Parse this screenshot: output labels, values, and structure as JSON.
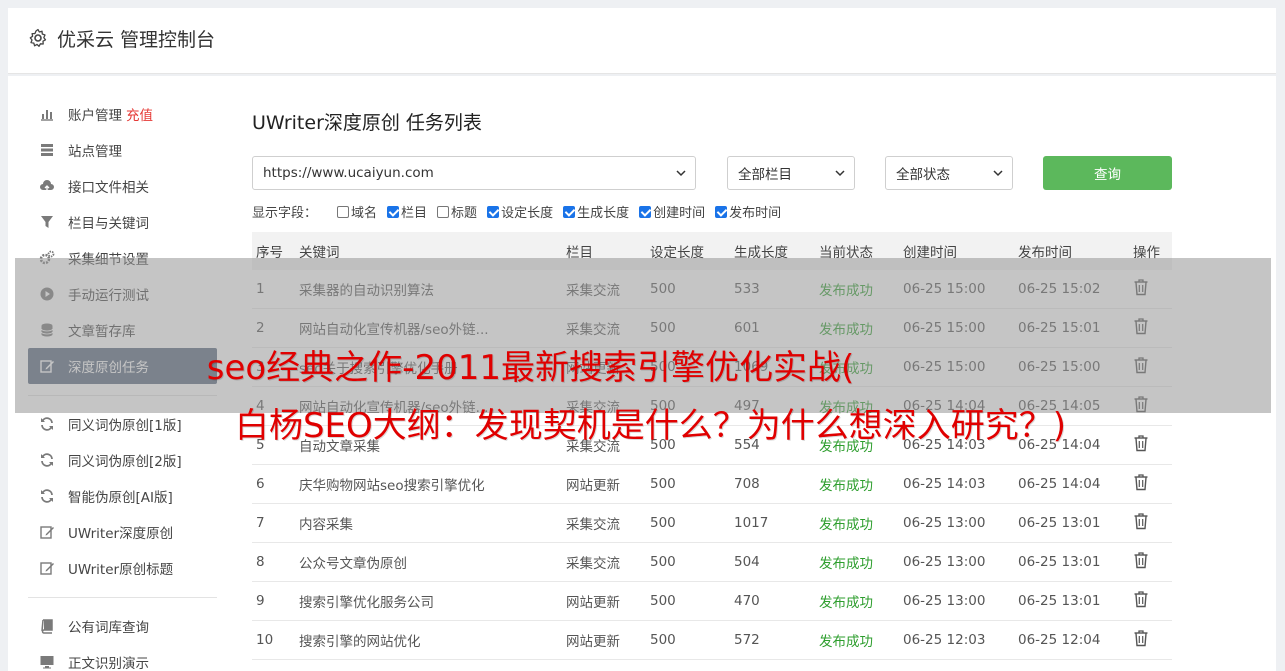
{
  "header": {
    "title": "优采云 管理控制台"
  },
  "sidebar": {
    "groups": [
      [
        {
          "label": "账户管理",
          "badge": "充值",
          "icon": "bar-chart-icon"
        },
        {
          "label": "站点管理",
          "icon": "server-icon"
        },
        {
          "label": "接口文件相关",
          "icon": "cloud-upload-icon"
        },
        {
          "label": "栏目与关键词",
          "icon": "filter-icon"
        },
        {
          "label": "采集细节设置",
          "icon": "gears-icon"
        },
        {
          "label": "手动运行测试",
          "icon": "play-icon"
        },
        {
          "label": "文章暂存库",
          "icon": "database-icon"
        },
        {
          "label": "深度原创任务",
          "icon": "edit-icon",
          "active": true
        }
      ],
      [
        {
          "label": "同义词伪原创[1版]",
          "icon": "refresh-icon"
        },
        {
          "label": "同义词伪原创[2版]",
          "icon": "refresh-icon"
        },
        {
          "label": "智能伪原创[AI版]",
          "icon": "refresh-icon"
        },
        {
          "label": "UWriter深度原创",
          "icon": "edit-icon"
        },
        {
          "label": "UWriter原创标题",
          "icon": "edit-icon"
        }
      ],
      [
        {
          "label": "公有词库查询",
          "icon": "book-icon"
        },
        {
          "label": "正文识别演示",
          "icon": "monitor-icon"
        }
      ]
    ]
  },
  "main": {
    "title": "UWriter深度原创 任务列表",
    "url_select": "https://www.ucaiyun.com",
    "column_select": "全部栏目",
    "status_select": "全部状态",
    "query_button": "查询",
    "fields_label": "显示字段：",
    "fields": [
      {
        "label": "域名",
        "checked": false
      },
      {
        "label": "栏目",
        "checked": true
      },
      {
        "label": "标题",
        "checked": false
      },
      {
        "label": "设定长度",
        "checked": true
      },
      {
        "label": "生成长度",
        "checked": true
      },
      {
        "label": "创建时间",
        "checked": true
      },
      {
        "label": "发布时间",
        "checked": true
      }
    ],
    "columns": [
      "序号",
      "关键词",
      "栏目",
      "设定长度",
      "生成长度",
      "当前状态",
      "创建时间",
      "发布时间",
      "操作"
    ],
    "rows": [
      [
        "1",
        "采集器的自动识别算法",
        "采集交流",
        "500",
        "533",
        "发布成功",
        "06-25 15:00",
        "06-25 15:02"
      ],
      [
        "2",
        "网站自动化宣传机器/seo外链...",
        "采集交流",
        "500",
        "601",
        "发布成功",
        "06-25 15:00",
        "06-25 15:01"
      ],
      [
        "3",
        "seo关于搜索引擎优化手册",
        "网站更新",
        "500",
        "1069",
        "发布成功",
        "06-25 15:00",
        "06-25 15:00"
      ],
      [
        "4",
        "网站自动化宣传机器/seo外链...",
        "采集交流",
        "500",
        "497",
        "发布成功",
        "06-25 14:04",
        "06-25 14:05"
      ],
      [
        "5",
        "自动文章采集",
        "采集交流",
        "500",
        "554",
        "发布成功",
        "06-25 14:03",
        "06-25 14:04"
      ],
      [
        "6",
        "庆华购物网站seo搜索引擎优化",
        "网站更新",
        "500",
        "708",
        "发布成功",
        "06-25 14:03",
        "06-25 14:04"
      ],
      [
        "7",
        "内容采集",
        "采集交流",
        "500",
        "1017",
        "发布成功",
        "06-25 13:00",
        "06-25 13:01"
      ],
      [
        "8",
        "公众号文章伪原创",
        "采集交流",
        "500",
        "504",
        "发布成功",
        "06-25 13:00",
        "06-25 13:01"
      ],
      [
        "9",
        "搜索引擎优化服务公司",
        "网站更新",
        "500",
        "470",
        "发布成功",
        "06-25 13:00",
        "06-25 13:01"
      ],
      [
        "10",
        "搜索引擎的网站优化",
        "网站更新",
        "500",
        "572",
        "发布成功",
        "06-25 12:03",
        "06-25 12:04"
      ]
    ]
  },
  "overlay": {
    "line1": "seo经典之作-2011最新搜索引擎优化实战(",
    "line2": "白杨SEO大纲：发现契机是什么？为什么想深入研究？)"
  },
  "colors": {
    "accent": "#5cb85c",
    "success": "#2e9e2e",
    "active_nav": "#5b6a80",
    "badge": "#e53935",
    "overlay_text": "#e00000"
  }
}
